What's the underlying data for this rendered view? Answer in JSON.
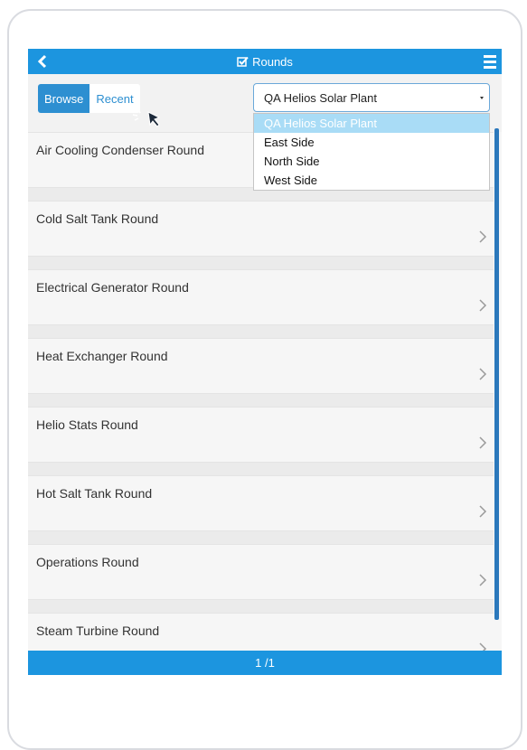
{
  "header": {
    "title": "Rounds"
  },
  "toolbar": {
    "browse_label": "Browse",
    "recent_label": "Recent",
    "site_selected": "QA Helios Solar Plant",
    "site_options": [
      "QA Helios Solar Plant",
      "East Side",
      "North Side",
      "West Side"
    ]
  },
  "rounds": [
    "Air Cooling Condenser Round",
    "Cold Salt Tank Round",
    "Electrical Generator Round",
    "Heat Exchanger Round",
    "Helio Stats Round",
    "Hot Salt Tank Round",
    "Operations Round",
    "Steam Turbine Round"
  ],
  "footer": {
    "page": "1 /1"
  },
  "colors": {
    "header": "#1c95df",
    "accent": "#2d8fd1",
    "selected_option": "#a9dcf6"
  }
}
